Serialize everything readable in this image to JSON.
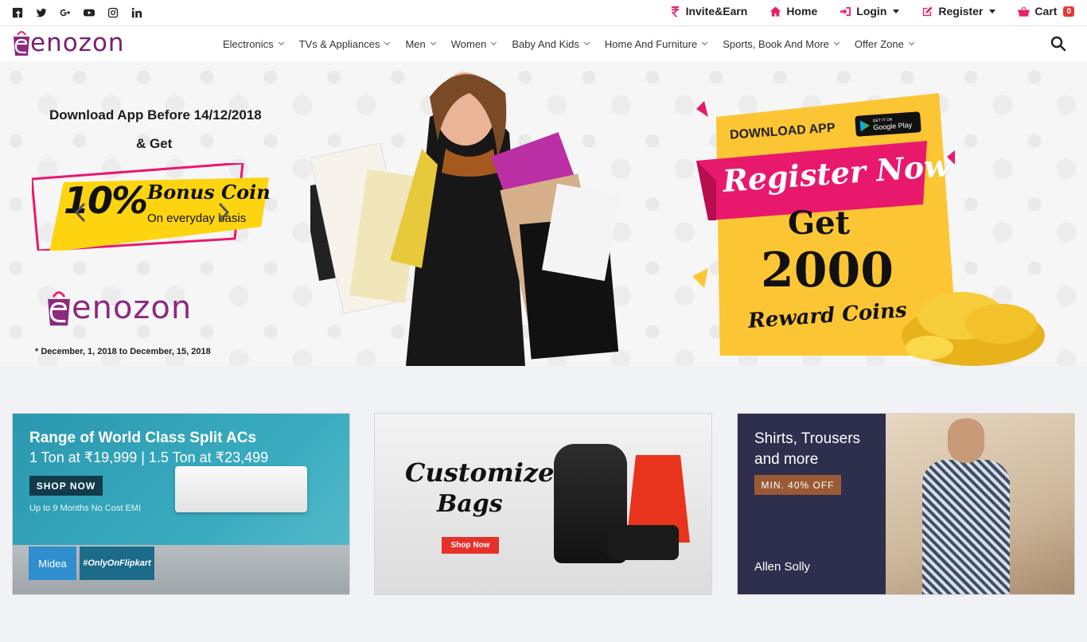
{
  "topbar": {
    "social": [
      "facebook-icon",
      "twitter-icon",
      "google-plus-icon",
      "youtube-icon",
      "instagram-icon",
      "linkedin-icon"
    ],
    "links": {
      "invite": "Invite&Earn",
      "home": "Home",
      "login": "Login",
      "register": "Register",
      "cart": "Cart",
      "cart_count": "0"
    }
  },
  "nav": {
    "logo": "enozon",
    "items": [
      "Electronics",
      "TVs & Appliances",
      "Men",
      "Women",
      "Baby And Kids",
      "Home And Furniture",
      "Sports, Book And More",
      "Offer Zone"
    ]
  },
  "hero": {
    "left_title": "Download App Before 14/12/2018",
    "left_sub": "& Get",
    "coin_pct": "10%",
    "coin_title": "Bonus Coin",
    "coin_sub": "On everyday basis",
    "logo": "enozon",
    "note": "* December, 1, 2018 to December, 15, 2018",
    "promo": {
      "download": "DOWNLOAD APP",
      "store_small": "GET IT ON",
      "store": "Google Play",
      "register": "Register Now",
      "get": "Get",
      "amount": "2000",
      "reward": "Reward Coins"
    }
  },
  "banners": {
    "ac": {
      "title": "Range of World Class Split ACs",
      "sub": "1 Ton at ₹19,999 | 1.5 Ton at ₹23,499",
      "button": "SHOP NOW",
      "emi": "Up to 9 Months No Cost EMI",
      "brand": "Midea",
      "tag": "#OnlyOnFlipkart"
    },
    "bags": {
      "title": "Customized",
      "sub": "Bags",
      "button": "Shop Now"
    },
    "shirts": {
      "title": "Shirts, Trousers and more",
      "button": "MIN. 40% OFF",
      "brand": "Allen Solly"
    }
  },
  "colors": {
    "accent": "#e91e63",
    "brand": "#7b1f6e",
    "promo_yellow": "#fcc533",
    "promo_pink": "#e8196d"
  }
}
